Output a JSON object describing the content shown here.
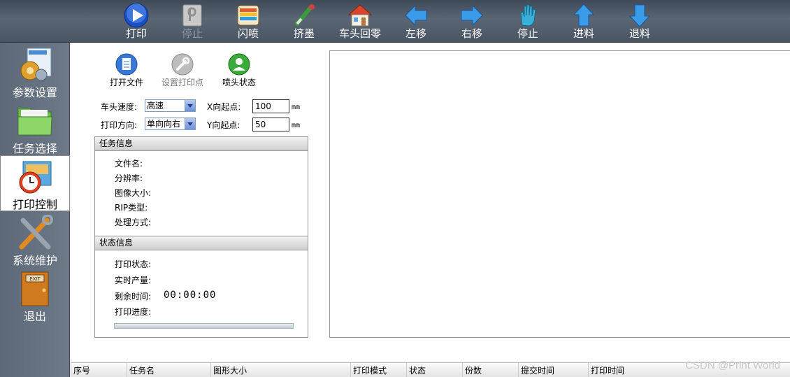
{
  "toolbar": {
    "items": [
      {
        "label": "打印",
        "icon": "play-icon"
      },
      {
        "label": "停止",
        "icon": "pause-icon",
        "disabled": true
      },
      {
        "label": "闪喷",
        "icon": "flash-spray-icon"
      },
      {
        "label": "挤墨",
        "icon": "ink-dropper-icon"
      },
      {
        "label": "车头回零",
        "icon": "home-icon"
      },
      {
        "label": "左移",
        "icon": "arrow-left-icon"
      },
      {
        "label": "右移",
        "icon": "arrow-right-icon"
      },
      {
        "label": "停止",
        "icon": "hand-stop-icon"
      },
      {
        "label": "进料",
        "icon": "arrow-up-icon"
      },
      {
        "label": "退料",
        "icon": "arrow-down-icon"
      }
    ]
  },
  "sidebar": {
    "items": [
      {
        "label": "参数设置",
        "icon": "settings-gears-icon"
      },
      {
        "label": "任务选择",
        "icon": "folder-icon"
      },
      {
        "label": "打印控制",
        "icon": "clock-control-icon",
        "active": true
      },
      {
        "label": "系统维护",
        "icon": "tools-icon"
      },
      {
        "label": "退出",
        "icon": "exit-door-icon"
      }
    ]
  },
  "actions": {
    "open_file": "打开文件",
    "set_print_point": "设置打印点",
    "nozzle_status": "喷头状态"
  },
  "form": {
    "head_speed_label": "车头速度:",
    "head_speed_value": "高速",
    "print_direction_label": "打印方向:",
    "print_direction_value": "单向向右",
    "x_start_label": "X向起点:",
    "x_start_value": "100",
    "y_start_label": "Y向起点:",
    "y_start_value": "50",
    "unit": "mm"
  },
  "task_info": {
    "title": "任务信息",
    "file_name": "文件名:",
    "resolution": "分辨率:",
    "image_size": "图像大小:",
    "rip_type": "RIP类型:",
    "process_mode": "处理方式:"
  },
  "status_info": {
    "title": "状态信息",
    "print_status": "打印状态:",
    "realtime_output": "实时产量:",
    "remaining_time_label": "剩余时间:",
    "remaining_time_value": "00:00:00",
    "print_progress": "打印进度:"
  },
  "table": {
    "columns": [
      "序号",
      "任务名",
      "图形大小",
      "打印模式",
      "状态",
      "份数",
      "提交时间",
      "打印时间"
    ]
  },
  "watermark": "CSDN @Print World",
  "colors": {
    "toolbar_bg": "#4a5564",
    "sidebar_bg": "#66717f",
    "accent_blue": "#2a6fd6"
  }
}
